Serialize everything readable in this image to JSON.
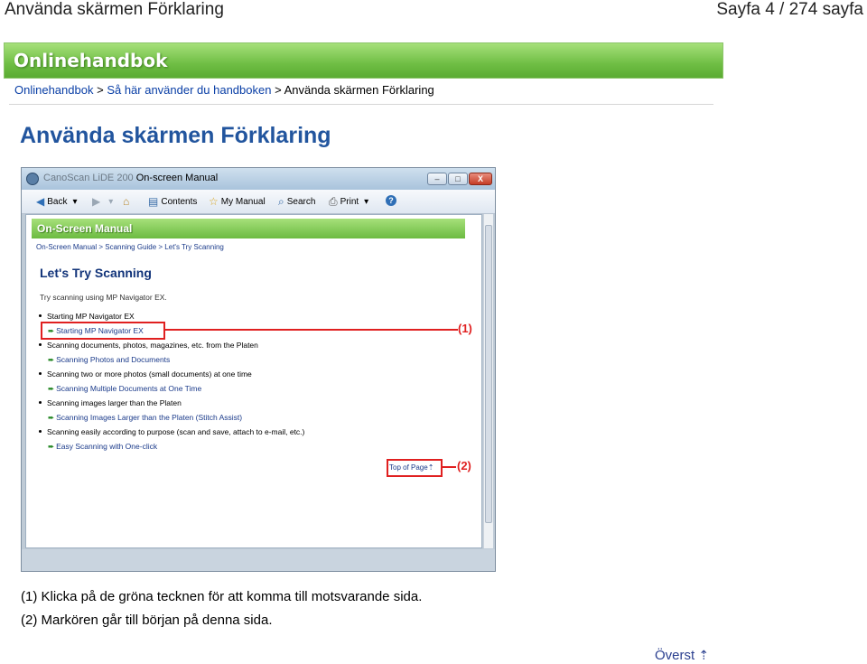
{
  "document": {
    "title": "Använda skärmen Förklaring",
    "page_count": "Sayfa 4 / 274 sayfa"
  },
  "banner": {
    "title": "Onlinehandbok"
  },
  "breadcrumb": {
    "items": [
      "Onlinehandbok",
      "Så här använder du handboken",
      "Använda skärmen Förklaring"
    ],
    "separator": ">"
  },
  "page_heading": "Använda skärmen Förklaring",
  "screenshot": {
    "window": {
      "title_blurred": "CanoScan LiDE 200",
      "title": "On-screen Manual",
      "buttons": {
        "minimize": "–",
        "maximize": "□",
        "close": "X"
      }
    },
    "toolbar": {
      "back": "Back",
      "contents": "Contents",
      "my_manual": "My Manual",
      "search": "Search",
      "print": "Print"
    },
    "content": {
      "banner": "On-Screen Manual",
      "breadcrumb": "On-Screen Manual > Scanning Guide > Let's Try Scanning",
      "heading": "Let's Try Scanning",
      "intro": "Try scanning using MP Navigator EX.",
      "items": [
        {
          "label": "Starting MP Navigator EX",
          "sublink": "Starting MP Navigator EX"
        },
        {
          "label": "Scanning documents, photos, magazines, etc. from the Platen",
          "sublink": "Scanning Photos and Documents"
        },
        {
          "label": "Scanning two or more photos (small documents) at one time",
          "sublink": "Scanning Multiple Documents at One Time"
        },
        {
          "label": "Scanning images larger than the Platen",
          "sublink": "Scanning Images Larger than the Platen (Stitch Assist)"
        },
        {
          "label": "Scanning easily according to purpose (scan and save, attach to e-mail, etc.)",
          "sublink": "Easy Scanning with One-click"
        }
      ],
      "top_link": "Top of Page"
    },
    "callouts": [
      "(1)",
      "(2)"
    ]
  },
  "notes": [
    "(1) Klicka på de gröna tecknen för att komma till motsvarande sida.",
    "(2) Markören går till början på denna sida."
  ],
  "back_to_top": "Överst",
  "icons": {
    "back_to_top": "up-arrow-icon"
  },
  "colors": {
    "heading": "#22559e",
    "banner_green": "#6fbe44",
    "callout_red": "#e02020"
  }
}
